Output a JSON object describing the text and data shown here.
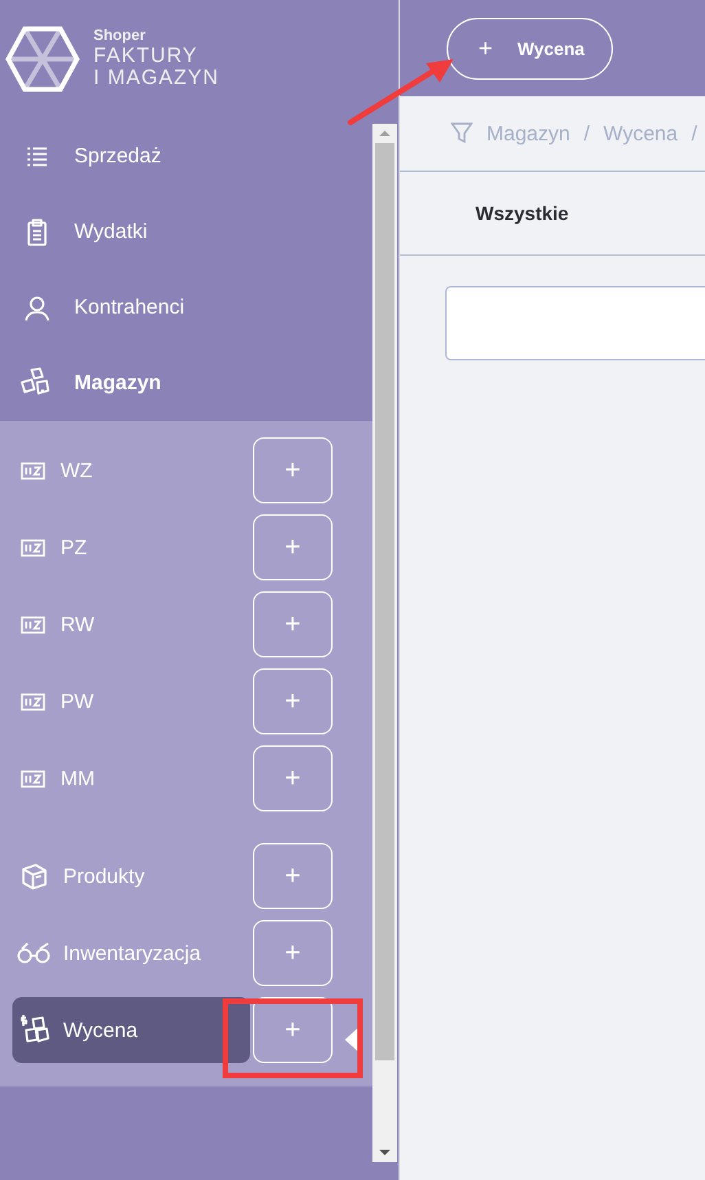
{
  "logo": {
    "brand": "Shoper",
    "line_1": "FAKTURY",
    "line_2": "I MAGAZYN"
  },
  "nav": [
    {
      "label": "Sprzedaż",
      "kind": "list",
      "selected": false
    },
    {
      "label": "Wydatki",
      "kind": "clipboard",
      "selected": false
    },
    {
      "label": "Kontrahenci",
      "kind": "person",
      "selected": false
    },
    {
      "label": "Magazyn",
      "kind": "boxes",
      "selected": true
    }
  ],
  "documents": [
    {
      "label": "WZ",
      "add": "+",
      "selected": false
    },
    {
      "label": "PZ",
      "add": "+",
      "selected": false
    },
    {
      "label": "RW",
      "add": "+",
      "selected": false
    },
    {
      "label": "PW",
      "add": "+",
      "selected": false
    },
    {
      "label": "MM",
      "add": "+",
      "selected": false
    }
  ],
  "modules": [
    {
      "label": "Produkty",
      "kind": "box",
      "add": "+",
      "selected": false
    },
    {
      "label": "Inwentaryzacja",
      "kind": "glasses",
      "add": "+",
      "selected": false
    },
    {
      "label": "Wycena",
      "kind": "priced-boxes",
      "add": "+",
      "selected": true
    }
  ],
  "header_button": {
    "icon": "+",
    "label": "Wycena"
  },
  "breadcrumb": {
    "items": [
      "Magazyn",
      "Wycena"
    ],
    "separator": "/"
  },
  "tabs": [
    {
      "label": "Wszystkie",
      "selected": true
    }
  ]
}
